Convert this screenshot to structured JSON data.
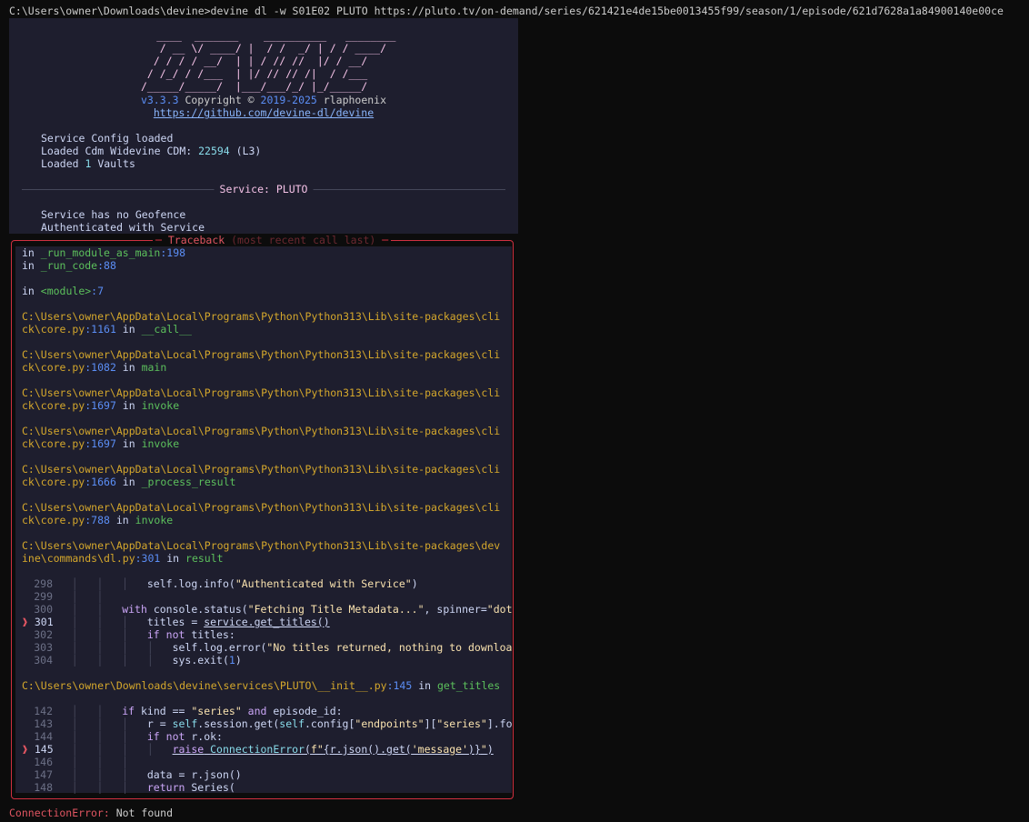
{
  "command": "C:\\Users\\owner\\Downloads\\devine>devine dl -w S01E02 PLUTO https://pluto.tv/on-demand/series/621421e4de15be0013455f99/season/1/episode/621d7628a1a84900140e00ce",
  "banner": {
    "ascii": [
      "    ____  _______    __________   ________",
      "   / __ \\/ ____/ |  / /  _/ | / / ____/",
      "  / / / / __/  | | / // //  |/ / __/   ",
      " / /_/ / /___  | |/ // // /|  / /___   ",
      "/_____/_____/  |___/___/_/ |_/_____/   "
    ],
    "version": "v3.3.3",
    "copyright_word": "Copyright ©",
    "years": "2019-2025",
    "author": "rlaphoenix",
    "link": "https://github.com/devine-dl/devine",
    "status_lines": {
      "l1": "Service Config loaded",
      "l2_prefix": "Loaded Cdm Widevine CDM: ",
      "l2_num": "22594",
      "l2_suffix": " (L3)",
      "l3_prefix": "Loaded ",
      "l3_num": "1",
      "l3_suffix": " Vaults"
    },
    "rule_label": "Service: PLUTO",
    "after_rule": {
      "l1": "Service has no Geofence",
      "l2": "Authenticated with Service"
    }
  },
  "traceback": {
    "title": "Traceback",
    "subtitle": "(most recent call last)",
    "frames": {
      "f1_in": "in ",
      "f1_fn": "_run_module_as_main",
      "f1_ln": ":198",
      "f2_in": "in ",
      "f2_fn": "_run_code",
      "f2_ln": ":88",
      "f3_in": "in ",
      "f3_fn": "<module>",
      "f3_ln": ":7",
      "click_path_a": "C:\\Users\\owner\\AppData\\Local\\Programs\\Python\\Python313\\Lib\\site-packages\\cli",
      "click_path_b": "ck\\core.py",
      "f4_ln": ":1161",
      "f4_in": " in ",
      "f4_fn": "__call__",
      "f5_ln": ":1082",
      "f5_in": " in ",
      "f5_fn": "main",
      "f6_ln": ":1697",
      "f6_in": " in ",
      "f6_fn": "invoke",
      "f7_ln": ":1697",
      "f7_in": " in ",
      "f7_fn": "invoke",
      "f8_ln": ":1666",
      "f8_in": " in ",
      "f8_fn": "_process_result",
      "f9_ln": ":788",
      "f9_in": " in ",
      "f9_fn": "invoke",
      "dev_path_a": "C:\\Users\\owner\\AppData\\Local\\Programs\\Python\\Python313\\Lib\\site-packages\\dev",
      "dev_path_b": "ine\\commands\\dl.py",
      "f10_ln": ":301",
      "f10_in": " in ",
      "f10_fn": "result",
      "pluto_path": "C:\\Users\\owner\\Downloads\\devine\\services\\PLUTO\\__init__.py",
      "f11_ln": ":145",
      "f11_in": " in ",
      "f11_fn": "get_titles"
    },
    "code1": {
      "n298": "298",
      "n299": "299",
      "n300": "300",
      "n301": "301",
      "n302": "302",
      "n303": "303",
      "n304": "304",
      "c298a": "self.log.info(",
      "c298s": "\"Authenticated with Service\"",
      "c298b": ")",
      "c300k": "with",
      "c300a": " console.status(",
      "c300s": "\"Fetching Title Metadata...\"",
      "c300b": ", spinner=",
      "c300s2": "\"dot",
      "c301a": "titles = ",
      "c301u": "service.get_titles()",
      "c302k": "if",
      "c302k2": " not",
      "c302a": " titles:",
      "c303a": "self.log.error(",
      "c303s": "\"No titles returned, nothing to downloa",
      "c304a": "sys.exit(",
      "c304n": "1",
      "c304b": ")"
    },
    "code2": {
      "n142": "142",
      "n143": "143",
      "n144": "144",
      "n145": "145",
      "n146": "146",
      "n147": "147",
      "n148": "148",
      "c142k": "if",
      "c142a": " kind == ",
      "c142s": "\"series\"",
      "c142k2": " and",
      "c142b": " episode_id:",
      "c143a": "r = ",
      "c143b": "self",
      "c143c": ".session.get(",
      "c143d": "self",
      "c143e": ".config[",
      "c143s": "\"endpoints\"",
      "c143f": "][",
      "c143s2": "\"series\"",
      "c143g": "].fo",
      "c144k": "if",
      "c144k2": " not",
      "c144a": " r.ok:",
      "c145k": "raise",
      "c145e": "ConnectionError",
      "c145a": "(",
      "c145f": "f\"",
      "c145b": "{r.json().get(",
      "c145s": "'message'",
      "c145c": ")}",
      "c145g": "\"",
      "c145d": ")",
      "c147a": "data = r.json()",
      "c148k": "return",
      "c148a": " Series("
    },
    "marker": "❱"
  },
  "error": {
    "name": "ConnectionError:",
    "message": " Not found"
  }
}
